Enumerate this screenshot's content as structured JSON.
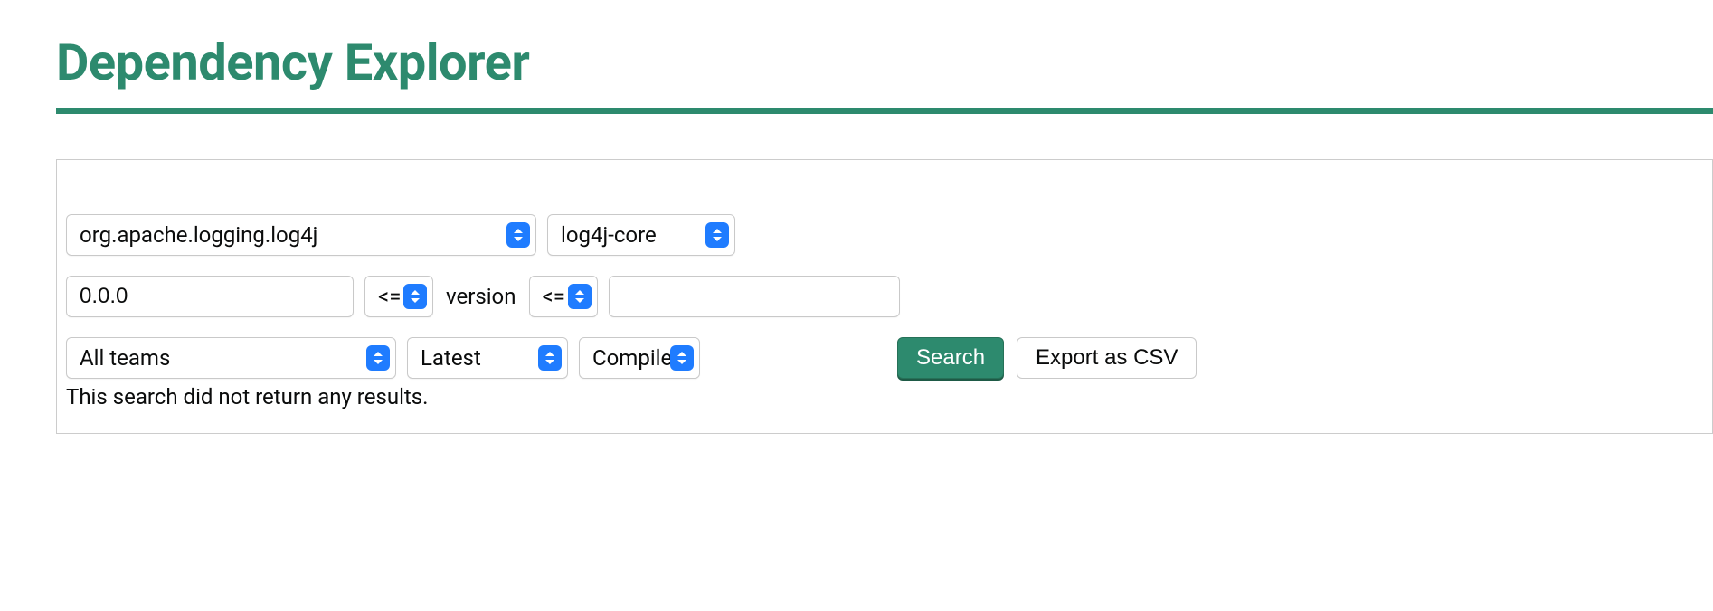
{
  "header": {
    "title": "Dependency Explorer"
  },
  "form": {
    "group_id": "org.apache.logging.log4j",
    "artifact_id": "log4j-core",
    "lower_version": "0.0.0",
    "lower_op": "<=",
    "mid_label": "version",
    "upper_op": "<=",
    "upper_version": "",
    "team": "All teams",
    "flag": "Latest",
    "scope": "Compile"
  },
  "buttons": {
    "search": "Search",
    "export": "Export as CSV"
  },
  "results": {
    "empty_message": "This search did not return any results."
  }
}
